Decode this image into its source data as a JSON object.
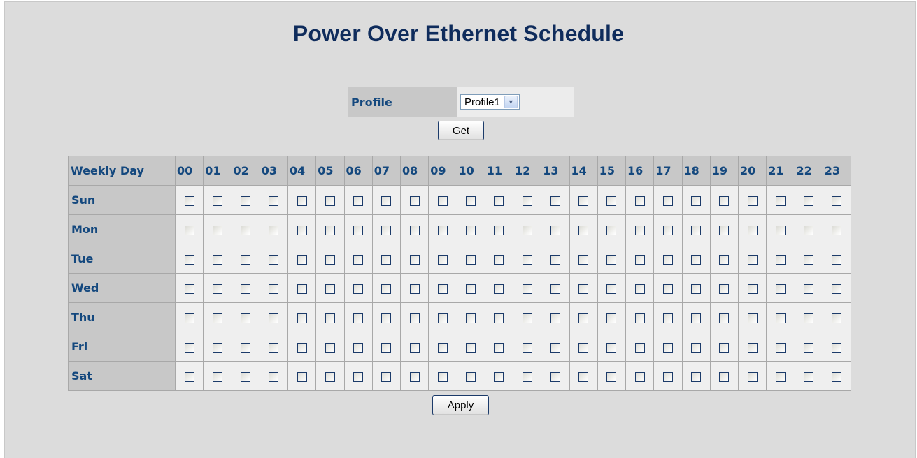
{
  "page": {
    "title": "Power Over Ethernet Schedule"
  },
  "profile": {
    "label": "Profile",
    "selected": "Profile1"
  },
  "buttons": {
    "get": "Get",
    "apply": "Apply"
  },
  "schedule": {
    "corner_header": "Weekly Day",
    "hours": [
      "00",
      "01",
      "02",
      "03",
      "04",
      "05",
      "06",
      "07",
      "08",
      "09",
      "10",
      "11",
      "12",
      "13",
      "14",
      "15",
      "16",
      "17",
      "18",
      "19",
      "20",
      "21",
      "22",
      "23"
    ],
    "days": [
      "Sun",
      "Mon",
      "Tue",
      "Wed",
      "Thu",
      "Fri",
      "Sat"
    ],
    "checked": []
  }
}
